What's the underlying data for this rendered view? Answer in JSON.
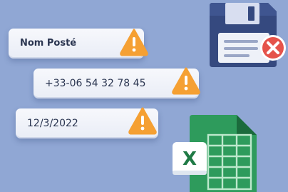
{
  "fields": [
    {
      "value": "Nom Posté",
      "status": "warning"
    },
    {
      "value": "+33-06 54 32 78 45",
      "status": "warning"
    },
    {
      "value": "12/3/2022",
      "status": "warning"
    }
  ],
  "icons": {
    "field_status": "warning-icon",
    "save_error": "floppy-disk-error-icon",
    "spreadsheet": "excel-file-icon",
    "excel_letter": "X"
  },
  "colors": {
    "background": "#90a7d4",
    "warning": "#f5a033",
    "error": "#e5534b",
    "disk": "#35497f",
    "excel_green": "#1f7a45"
  }
}
